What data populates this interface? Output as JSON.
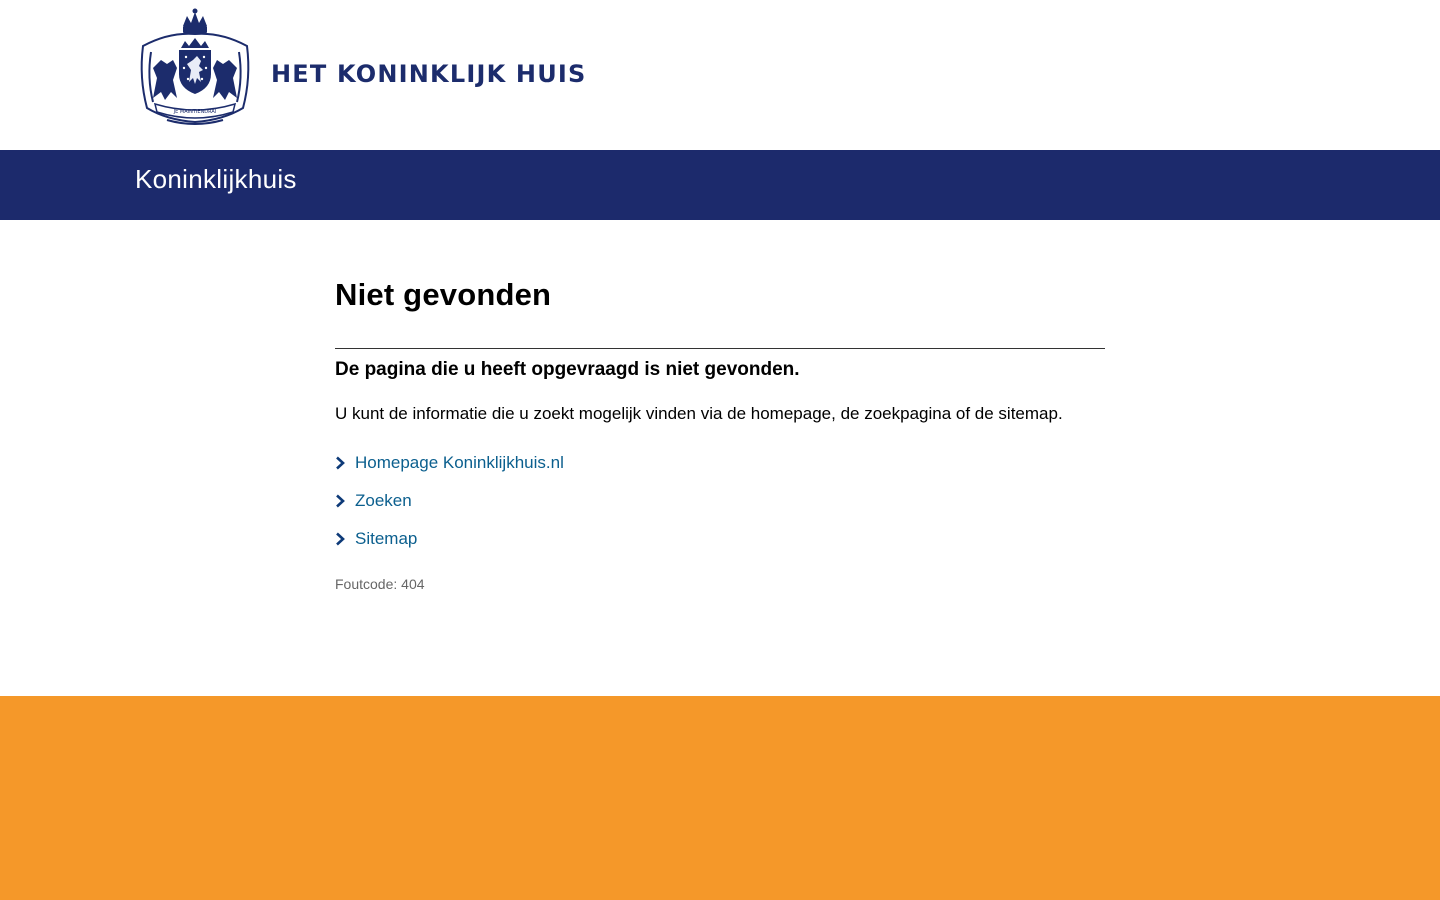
{
  "header": {
    "wordmark": "HET KONINKLIJK HUIS",
    "crest_motto": "JE MAINTIENDRAI",
    "crest_icon": "royal-coat-of-arms-icon"
  },
  "navbar": {
    "site_name": "Koninklijkhuis"
  },
  "main": {
    "title": "Niet gevonden",
    "lead": "De pagina die u heeft opgevraagd is niet gevonden.",
    "info": "U kunt de informatie die u zoekt mogelijk vinden via de homepage, de zoekpagina of de sitemap.",
    "links": [
      {
        "label": "Homepage Koninklijkhuis.nl",
        "icon": "chevron-right-icon"
      },
      {
        "label": "Zoeken",
        "icon": "chevron-right-icon"
      },
      {
        "label": "Sitemap",
        "icon": "chevron-right-icon"
      }
    ],
    "error_code": "Foutcode: 404"
  },
  "colors": {
    "brand_blue": "#1c2a6c",
    "link_blue": "#0b5f8e",
    "footer_orange": "#f59829"
  }
}
